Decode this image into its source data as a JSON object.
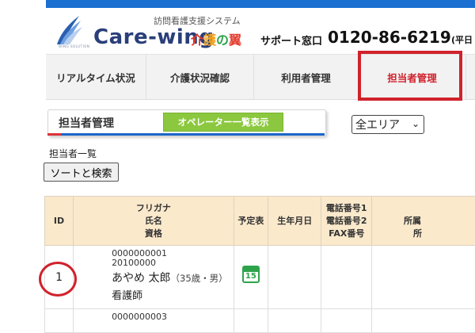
{
  "header": {
    "system_name": "訪問看護支援システム",
    "brand": "Care-wing",
    "brand_jp": [
      "介",
      "護",
      "の",
      "翼"
    ],
    "logo_sub": "WING SOLUTION",
    "support_label": "サポート窓口",
    "support_phone": "0120-86-6219",
    "support_hours": "(平日"
  },
  "nav": {
    "tabs": [
      {
        "label": "リアルタイム状況"
      },
      {
        "label": "介護状況確認"
      },
      {
        "label": "利用者管理"
      },
      {
        "label": "担当者管理",
        "active": true
      }
    ]
  },
  "section": {
    "title": "担当者管理",
    "operator_button": "オペレーター一覧表示"
  },
  "filters": {
    "area_select": "全エリア",
    "area_chevron": "⌄"
  },
  "list": {
    "label": "担当者一覧",
    "sort_button": "ソートと検索"
  },
  "table": {
    "headers": {
      "id": "ID",
      "kana": "フリガナ",
      "name": "氏名",
      "qualification": "資格",
      "schedule": "予定表",
      "birthdate": "生年月日",
      "phone1": "電話番号1",
      "phone2": "電話番号2",
      "fax": "FAX番号",
      "affiliation": "所属",
      "affiliation2": "所"
    },
    "rows": [
      {
        "id": "1",
        "code1": "0000000001",
        "code2": "20100000",
        "name": "あやめ 太郎",
        "age_gender": "（35歳・男）",
        "qualification": "看護師",
        "calendar_number": "15"
      },
      {
        "id": "",
        "code1": "0000000003",
        "code2": ""
      }
    ]
  },
  "colors": {
    "accent_red": "#d0222c",
    "header_blue": "#1a6fd1",
    "operator_green": "#8bc83f",
    "table_header": "#fbe9cc"
  }
}
